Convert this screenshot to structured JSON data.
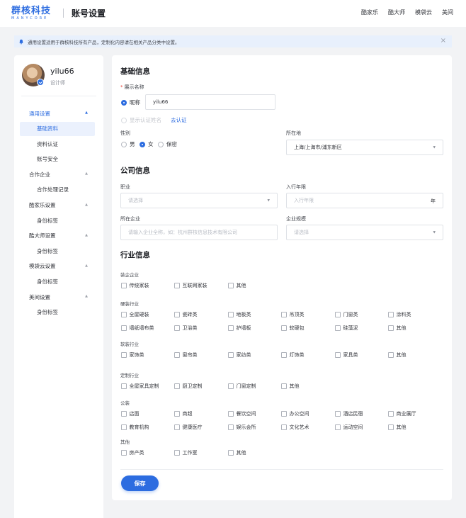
{
  "header": {
    "logo_cn": "群核科技",
    "logo_en": "MANYCORE",
    "page_title": "账号设置",
    "nav": [
      "酷家乐",
      "酷大师",
      "模袋云",
      "美间"
    ]
  },
  "notice": {
    "text": "通用设置适用于群核科技所有产品，定制化内容请在相关产品分类中设置。",
    "icon": "bell-icon"
  },
  "sidebar": {
    "username": "yilu66",
    "user_title": "设计师",
    "menu": [
      {
        "label": "通用设置",
        "type": "group",
        "active": true
      },
      {
        "label": "基础资料",
        "type": "item",
        "active": true
      },
      {
        "label": "资料认证",
        "type": "item"
      },
      {
        "label": "账号安全",
        "type": "item"
      },
      {
        "label": "合作企业",
        "type": "group"
      },
      {
        "label": "合作处理记录",
        "type": "item"
      },
      {
        "label": "酷家乐设置",
        "type": "group"
      },
      {
        "label": "身份标签",
        "type": "item"
      },
      {
        "label": "酷大师设置",
        "type": "group"
      },
      {
        "label": "身份标签",
        "type": "item"
      },
      {
        "label": "模袋云设置",
        "type": "group"
      },
      {
        "label": "身份标签",
        "type": "item"
      },
      {
        "label": "美间设置",
        "type": "group"
      },
      {
        "label": "身份标签",
        "type": "item"
      }
    ]
  },
  "basic": {
    "title": "基础信息",
    "display_name_label": "展示名称",
    "nickname_option": "昵称",
    "nickname_value": "yilu66",
    "verified_name_option": "显示认证姓名",
    "verify_link": "去认证",
    "gender_label": "性别",
    "genders": [
      "男",
      "女",
      "保密"
    ],
    "gender_selected": "女",
    "location_label": "所在地",
    "location_value": "上海/上海市/浦东新区"
  },
  "company": {
    "title": "公司信息",
    "job_label": "职业",
    "job_placeholder": "请选择",
    "year_label": "入行年限",
    "year_placeholder": "入行年限",
    "year_suffix": "年",
    "company_label": "所在企业",
    "company_placeholder": "请输入企业全称，如：杭州群核信息技术有限公司",
    "scale_label": "企业规模",
    "scale_placeholder": "请选择"
  },
  "industry": {
    "title": "行业信息",
    "categories": [
      {
        "label": "装企企业",
        "rows": [
          [
            "传统家装",
            "互联网家装",
            "其他"
          ]
        ]
      },
      {
        "label": "硬装行业",
        "rows": [
          [
            "全屋硬装",
            "瓷砖类",
            "地板类",
            "吊顶类",
            "门窗类",
            "涂料类"
          ],
          [
            "墙纸墙布类",
            "卫浴类",
            "护墙板",
            "软硬包",
            "硅藻泥",
            "其他"
          ]
        ]
      },
      {
        "label": "软装行业",
        "rows": [
          [
            "家饰类",
            "窗帘类",
            "家纺类",
            "灯饰类",
            "家具类",
            "其他"
          ]
        ]
      },
      {
        "label": "定制行业",
        "rows": [
          [
            "全屋家具定制",
            "厨卫定制",
            "门窗定制",
            "其他"
          ]
        ]
      },
      {
        "label": "公装",
        "rows": [
          [
            "店面",
            "商超",
            "餐饮空间",
            "办公空间",
            "酒店民宿",
            "商业展厅"
          ],
          [
            "教育机构",
            "健康医疗",
            "娱乐会所",
            "文化艺术",
            "运动空间",
            "其他"
          ]
        ]
      },
      {
        "label": "其他",
        "rows": [
          [
            "房产类",
            "工作室",
            "其他"
          ]
        ]
      }
    ]
  },
  "actions": {
    "save_label": "保存"
  }
}
